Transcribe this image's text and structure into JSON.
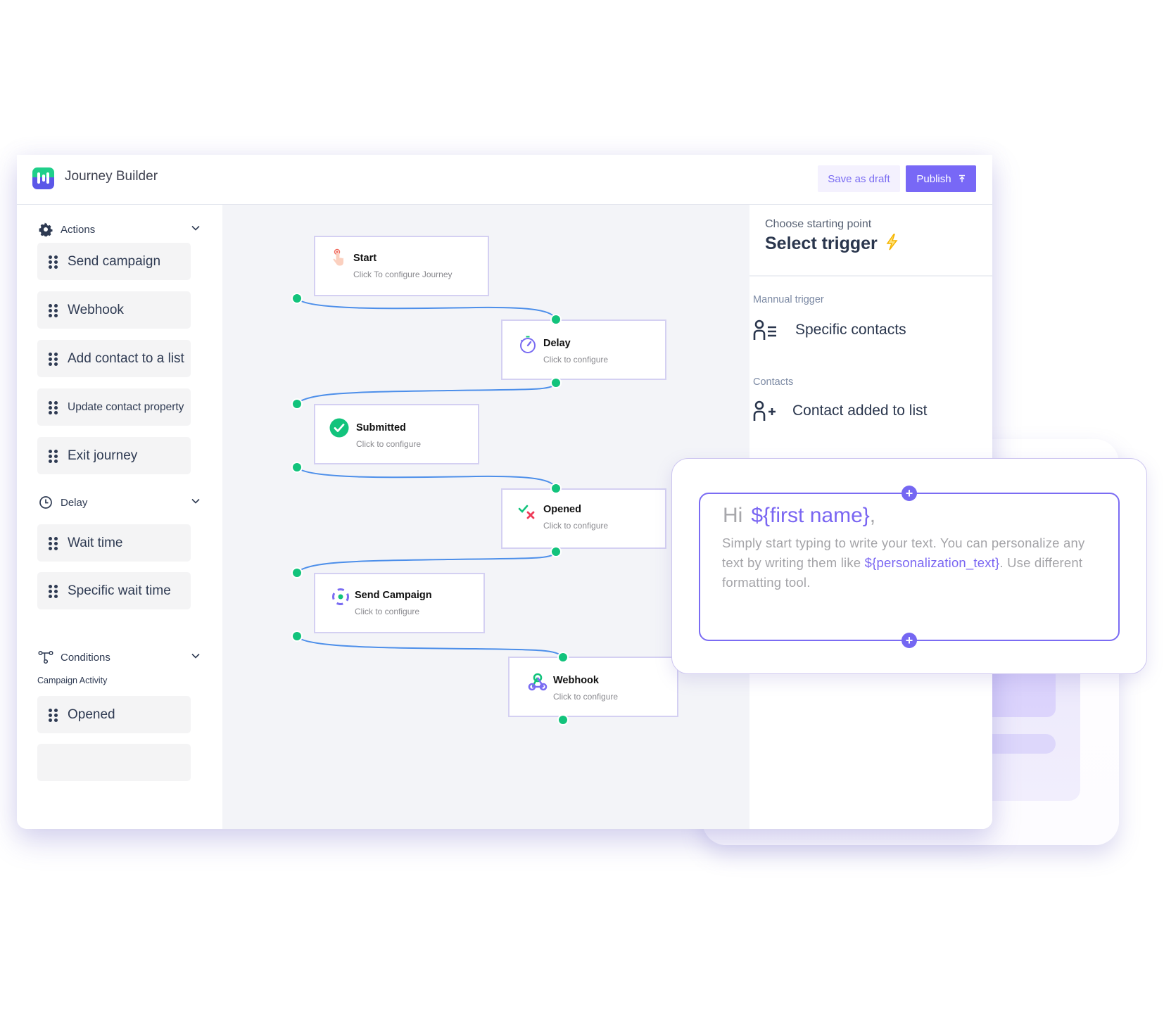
{
  "header": {
    "app_title": "Journey Builder",
    "save_draft_label": "Save as draft",
    "publish_label": "Publish",
    "publish_icon": "upload-arrow-icon"
  },
  "sidebar": {
    "sections": [
      {
        "title": "Actions",
        "icon": "gear-icon",
        "items": [
          "Send campaign",
          "Webhook",
          "Add contact to a list",
          "Update contact property",
          "Exit journey"
        ]
      },
      {
        "title": "Delay",
        "icon": "clock-icon",
        "items": [
          "Wait time",
          "Specific wait time"
        ]
      },
      {
        "title": "Conditions",
        "icon": "branch-icon",
        "sublabel": "Campaign Activity",
        "items": [
          "Opened"
        ]
      }
    ]
  },
  "canvas": {
    "nodes": [
      {
        "title": "Start",
        "subtitle": "Click To configure Journey",
        "icon": "tap-hand-icon"
      },
      {
        "title": "Delay",
        "subtitle": "Click to configure",
        "icon": "stopwatch-icon"
      },
      {
        "title": "Submitted",
        "subtitle": "Click to configure",
        "icon": "check-circle-icon"
      },
      {
        "title": "Opened",
        "subtitle": "Click to configure",
        "icon": "check-cross-icon"
      },
      {
        "title": "Send Campaign",
        "subtitle": "Click to configure",
        "icon": "target-icon"
      },
      {
        "title": "Webhook",
        "subtitle": "Click to configure",
        "icon": "webhook-icon"
      }
    ]
  },
  "trigger_panel": {
    "subtitle": "Choose starting point",
    "title": "Select trigger",
    "title_icon": "lightning-icon",
    "categories": [
      {
        "label": "Mannual trigger",
        "option": "Specific contacts",
        "icon": "user-list-icon"
      },
      {
        "label": "Contacts",
        "option": "Contact added to list",
        "icon": "user-add-icon"
      }
    ]
  },
  "editor_card": {
    "greeting": "Hi",
    "greeting_var": "${first name}",
    "greeting_suffix": ",",
    "body_before": "Simply start typing to write your text. You can personalize any text by writing them like ",
    "body_var": "${personalization_text}",
    "body_after": ". Use different formatting tool.",
    "add_above_icon": "plus-icon",
    "add_below_icon": "plus-icon"
  },
  "colors": {
    "accent": "#7868f6",
    "port": "#12c37c",
    "connector": "#4d8fea",
    "text_dark": "#2e3a52"
  }
}
